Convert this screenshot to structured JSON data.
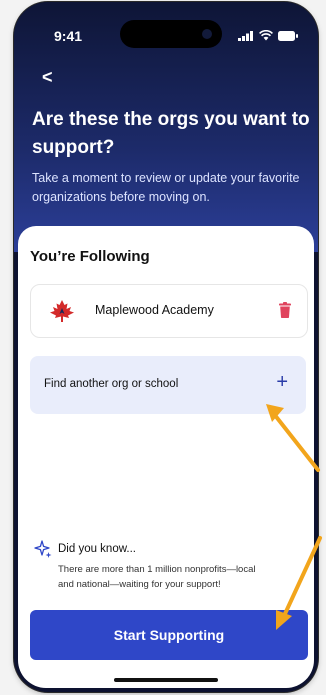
{
  "status_bar": {
    "time": "9:41"
  },
  "header": {
    "back_glyph": "<",
    "title": "Are these the orgs you want to support?",
    "subtitle": "Take a moment to review or update your favorite organizations before moving on."
  },
  "following": {
    "section_title": "You’re Following",
    "orgs": [
      {
        "name": "Maplewood Academy",
        "logo_icon": "maple-leaf-icon",
        "logo_color": "#d32a2a"
      }
    ],
    "remove_icon": "trash-icon",
    "remove_color": "#e0435d"
  },
  "find": {
    "label": "Find another org or school",
    "action_glyph": "+"
  },
  "tip": {
    "icon": "sparkle-icon",
    "title": "Did you know...",
    "body_line1": "There are more than 1 million nonprofits—local",
    "body_line2": "and national—waiting for your support!"
  },
  "cta": {
    "label": "Start Supporting"
  },
  "colors": {
    "accent": "#2f47c8",
    "hero_dark": "#0e1536",
    "hero_light": "#2c3f99",
    "annotation_arrow": "#f2a51c"
  }
}
